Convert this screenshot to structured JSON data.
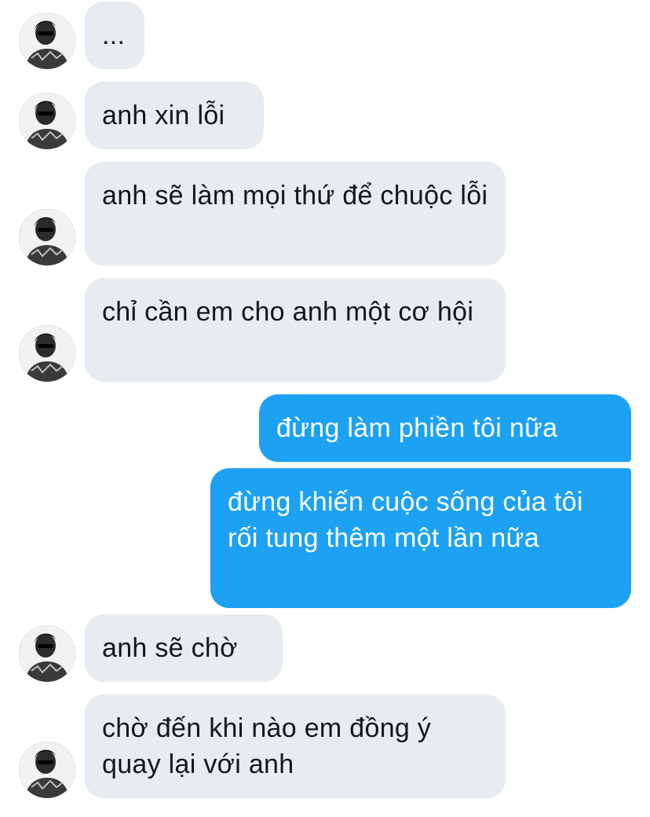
{
  "conversation": {
    "messages": [
      {
        "direction": "received",
        "text": "..."
      },
      {
        "direction": "received",
        "text": "anh xin lỗi"
      },
      {
        "direction": "received",
        "text": "anh sẽ làm mọi thứ để chuộc lỗi"
      },
      {
        "direction": "received",
        "text": "chỉ cần em cho anh một cơ hội"
      },
      {
        "direction": "sent",
        "text": "đừng làm phiền tôi nữa"
      },
      {
        "direction": "sent",
        "text": "đừng khiến cuộc sống của tôi rối tung thêm một lần nữa"
      },
      {
        "direction": "received",
        "text": "anh sẽ chờ"
      },
      {
        "direction": "received",
        "text": "chờ đến khi nào em đồng ý quay lại với anh"
      }
    ]
  },
  "colors": {
    "received_bubble": "#e6ecf0",
    "received_text": "#14171a",
    "sent_bubble": "#1da1f2",
    "sent_text": "#ffffff",
    "background": "#ffffff"
  },
  "icons": {
    "avatar": "contact-avatar-photo"
  }
}
